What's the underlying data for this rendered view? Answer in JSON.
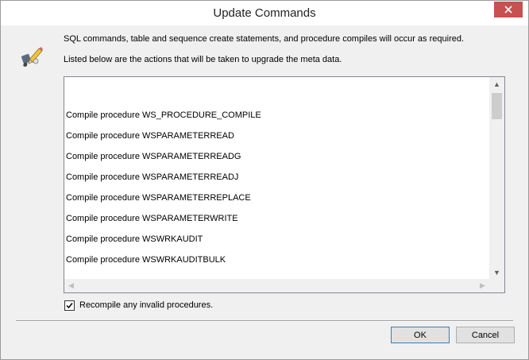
{
  "window": {
    "title": "Update Commands",
    "close_icon": "close-icon"
  },
  "icon": "wizard-pencil-icon",
  "messages": {
    "line1": "SQL commands, table and sequence create statements, and procedure compiles will occur as required.",
    "line2": "Listed below are the actions that will be taken to upgrade the meta data."
  },
  "actions_list": {
    "items": [
      "Compile procedure WS_PROCEDURE_COMPILE",
      "Compile procedure WSPARAMETERREAD",
      "Compile procedure WSPARAMETERREADG",
      "Compile procedure WSPARAMETERREADJ",
      "Compile procedure WSPARAMETERREPLACE",
      "Compile procedure WSPARAMETERWRITE",
      "Compile procedure WSWRKAUDIT",
      "Compile procedure WSWRKAUDITBULK"
    ]
  },
  "recompile": {
    "label": "Recompile any invalid procedures.",
    "checked": true
  },
  "buttons": {
    "ok": "OK",
    "cancel": "Cancel"
  }
}
